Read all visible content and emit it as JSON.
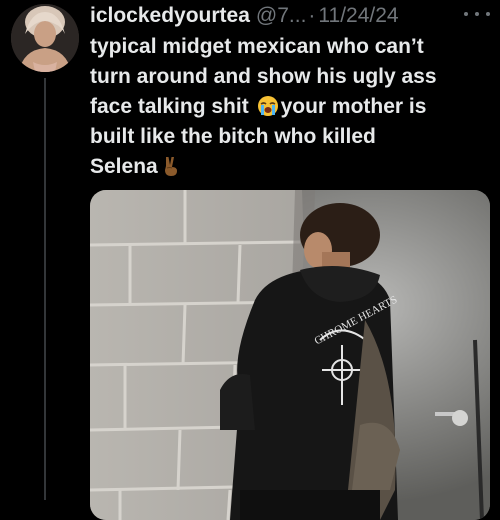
{
  "tweet": {
    "author": {
      "display_name": "iclockedyourtea",
      "handle": "@7...",
      "avatar_icon": "profile-avatar"
    },
    "separator": "·",
    "date": "11/24/24",
    "more_icon": "more-options-icon",
    "text_lines": [
      "typical midget mexican who can’t",
      "turn around and show his ugly ass",
      "face talking shit",
      "your mother is",
      "built like the bitch who killed",
      "Selena"
    ],
    "emojis": {
      "loudly_crying": "loudly-crying-face-emoji",
      "victory_hand": "victory-hand-emoji"
    },
    "media": {
      "type": "photo",
      "hoodie_text": "CHROME HEARTS"
    }
  },
  "colors": {
    "background": "#000000",
    "primary_text": "#e7e9ea",
    "secondary_text": "#71767b",
    "thread_line": "#333639"
  }
}
